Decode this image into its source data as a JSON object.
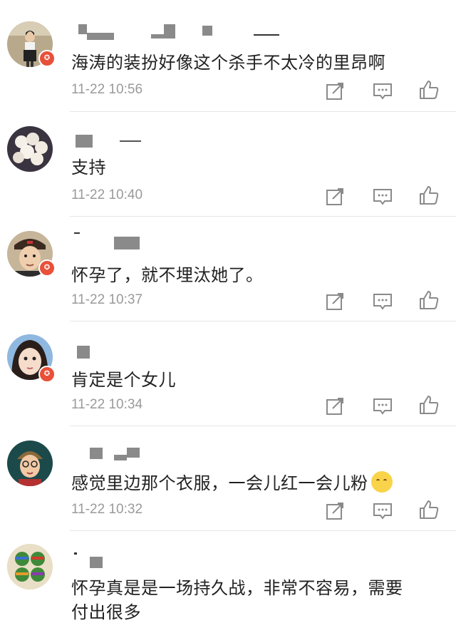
{
  "comments": [
    {
      "text": "海涛的装扮好像这个杀手不太冷的里昂啊",
      "time": "11-22 10:56",
      "vip": true,
      "avatar": "woman-standing-photo"
    },
    {
      "text": "支持",
      "time": "11-22 10:40",
      "vip": false,
      "avatar": "white-roses-photo"
    },
    {
      "text": "怀孕了，就不埋汰她了。",
      "time": "11-22 10:37",
      "vip": true,
      "avatar": "man-in-cap-photo"
    },
    {
      "text": "肯定是个女儿",
      "time": "11-22 10:34",
      "vip": true,
      "avatar": "girl-face-photo"
    },
    {
      "text": "感觉里边那个衣服，一会儿红一会儿粉",
      "time": "11-22 10:32",
      "vip": false,
      "avatar": "cartoon-character",
      "emoji": "thinking-emoji"
    },
    {
      "text": "怀孕真是是一场持久战，非常不容易，需要",
      "text_line2": "付出很多",
      "time": "",
      "vip": false,
      "avatar": "ninja-turtles-cartoon"
    }
  ],
  "icons": {
    "share": "share-icon",
    "reply": "comment-icon",
    "like": "thumbs-up-icon",
    "vip": "vip-badge-icon"
  },
  "colors": {
    "badge": "#e8503a",
    "text": "#222222",
    "time": "#9a9a9a",
    "icon": "#8a8a8a"
  }
}
